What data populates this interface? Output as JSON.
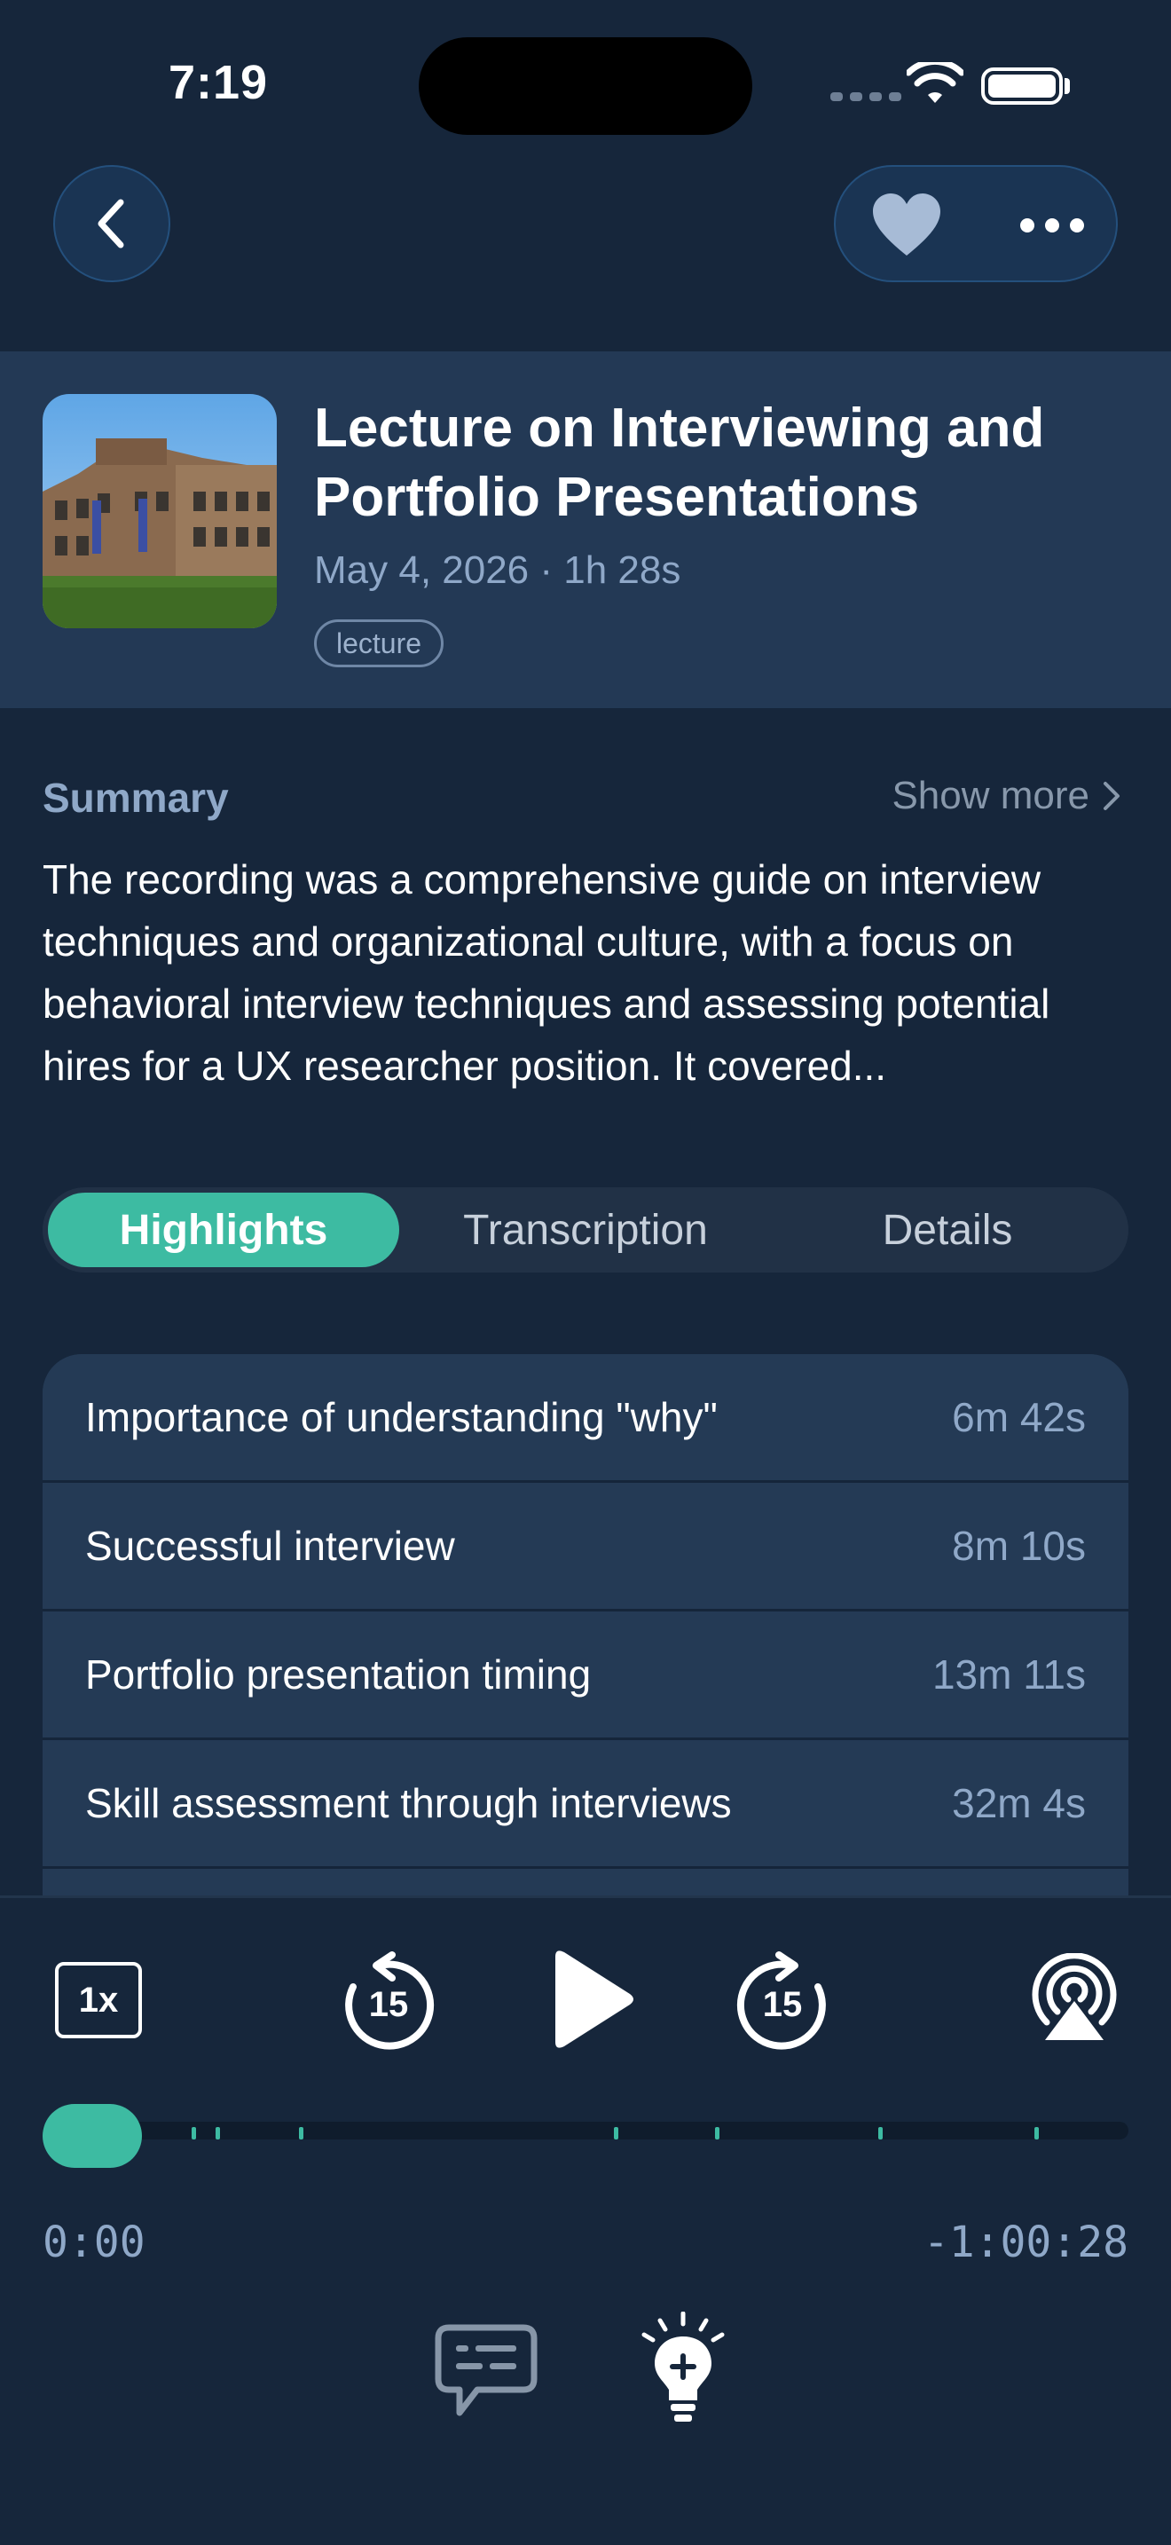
{
  "status_bar": {
    "time": "7:19"
  },
  "recording": {
    "title": "Lecture on Interviewing and Portfolio Presentations",
    "meta": "May 4, 2026 · 1h 28s",
    "tag": "lecture"
  },
  "summary": {
    "label": "Summary",
    "show_more": "Show more",
    "text": "The recording was a comprehensive guide on interview techniques and organizational culture, with a focus on behavioral interview techniques and assessing potential hires for a UX researcher position. It covered..."
  },
  "tabs": [
    {
      "label": "Highlights",
      "active": true
    },
    {
      "label": "Transcription",
      "active": false
    },
    {
      "label": "Details",
      "active": false
    }
  ],
  "highlights": [
    {
      "title": "Importance of understanding \"why\"",
      "time": "6m 42s"
    },
    {
      "title": "Successful interview",
      "time": "8m 10s"
    },
    {
      "title": "Portfolio presentation timing",
      "time": "13m 11s"
    },
    {
      "title": "Skill assessment through interviews",
      "time": "32m 4s"
    }
  ],
  "player": {
    "speed": "1x",
    "skip_back_seconds": "15",
    "skip_forward_seconds": "15",
    "elapsed": "0:00",
    "remaining": "-1:00:28",
    "progress": 0.0
  },
  "colors": {
    "background": "#16263b",
    "card": "#243a55",
    "accent": "#3dbba2",
    "muted_text": "#8fa8c8"
  },
  "icons": {
    "back": "chevron-left-icon",
    "favorite": "heart-icon",
    "more": "more-horizontal-icon",
    "skip_back": "rewind-15-icon",
    "play": "play-icon",
    "skip_forward": "forward-15-icon",
    "airplay": "airplay-icon",
    "transcript": "chat-bubble-icon",
    "add_highlight": "lightbulb-plus-icon"
  }
}
